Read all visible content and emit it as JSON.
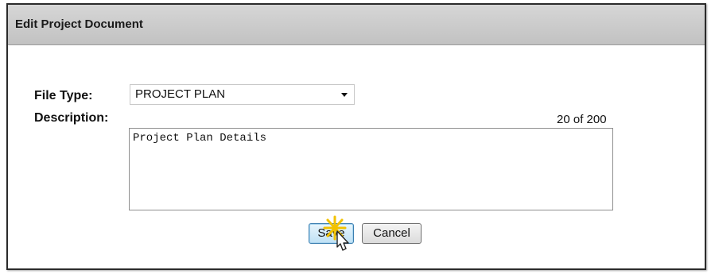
{
  "dialog": {
    "title": "Edit Project Document"
  },
  "form": {
    "file_type_label": "File Type:",
    "file_type_value": "PROJECT PLAN",
    "description_label": "Description:",
    "char_counter": "20 of 200",
    "description_value": "Project Plan Details"
  },
  "buttons": {
    "save_label": "Save",
    "cancel_label": "Cancel"
  },
  "colors": {
    "title_bar": "#c8c8c8",
    "save_button_highlight": "#bfe1f5",
    "click_burst": "#f2c200"
  },
  "icons": {
    "dropdown": "chevron-down-icon",
    "pointer": "hand-pointer-icon",
    "click": "click-burst-icon"
  }
}
